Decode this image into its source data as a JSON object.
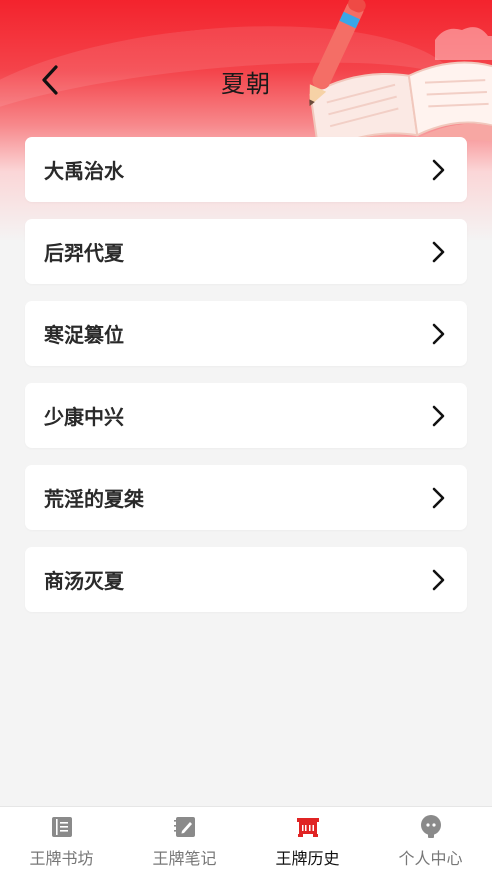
{
  "header": {
    "title": "夏朝",
    "back_icon": "chevron-left-icon"
  },
  "events": [
    {
      "label": "大禹治水"
    },
    {
      "label": "后羿代夏"
    },
    {
      "label": "寒浞篡位"
    },
    {
      "label": "少康中兴"
    },
    {
      "label": "荒淫的夏桀"
    },
    {
      "label": "商汤灭夏"
    }
  ],
  "tabbar": {
    "tabs": [
      {
        "label": "王牌书坊",
        "icon": "book-icon",
        "active": false
      },
      {
        "label": "王牌笔记",
        "icon": "notebook-icon",
        "active": false
      },
      {
        "label": "王牌历史",
        "icon": "history-icon",
        "active": true
      },
      {
        "label": "个人中心",
        "icon": "profile-icon",
        "active": false
      }
    ]
  },
  "colors": {
    "accent": "#e02424",
    "header_red": "#f3232d",
    "inactive_icon": "#8a8a8a",
    "background": "#f4f4f4"
  }
}
